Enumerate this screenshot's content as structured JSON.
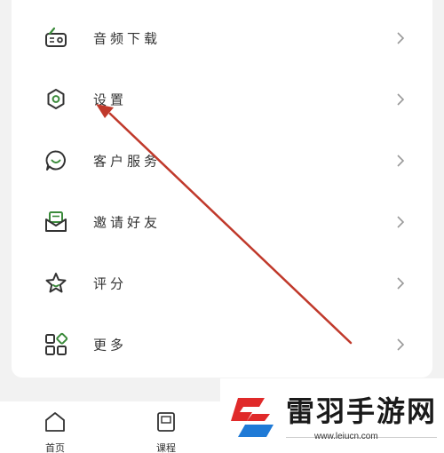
{
  "menu": {
    "items": [
      {
        "label": "音频下载",
        "icon": "radio-icon"
      },
      {
        "label": "设置",
        "icon": "gear-icon"
      },
      {
        "label": "客户服务",
        "icon": "chat-smile-icon"
      },
      {
        "label": "邀请好友",
        "icon": "envelope-icon"
      },
      {
        "label": "评分",
        "icon": "star-icon"
      },
      {
        "label": "更多",
        "icon": "grid-icon"
      }
    ]
  },
  "bottom_nav": {
    "items": [
      {
        "label": "首页",
        "icon": "home-icon"
      },
      {
        "label": "课程",
        "icon": "book-icon"
      }
    ]
  },
  "watermark": {
    "title": "雷羽手游网",
    "url": "www.leiucn.com"
  },
  "colors": {
    "accent": "#3a8a3a",
    "annotation_arrow": "#c0392b",
    "icon_stroke": "#333333"
  }
}
